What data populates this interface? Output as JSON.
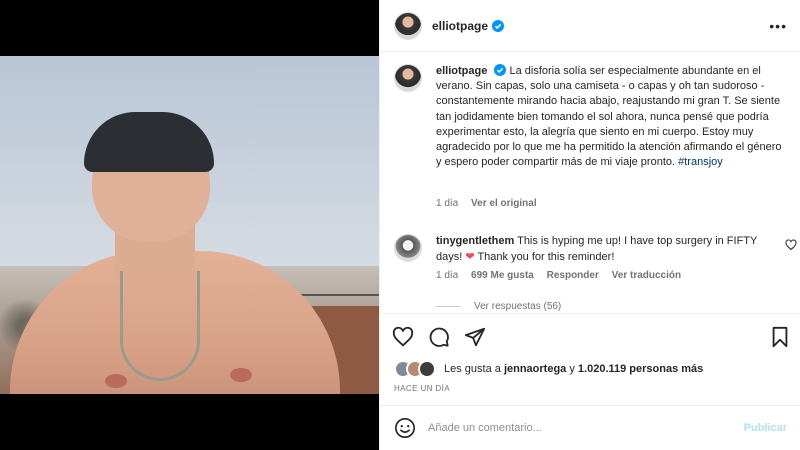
{
  "post": {
    "username": "elliotpage",
    "caption": "La disforia solía ser especialmente abundante en el verano. Sin capas, solo una camiseta - o capas y oh tan sudoroso - constantemente mirando hacia abajo, reajustando mi gran T. Se siente tan jodidamente bien tomando el sol ahora, nunca pensé que podría experimentar esto, la alegría que siento en mi cuerpo. Estoy muy agradecido por lo que me ha permitido la atención afirmando el género y espero poder compartir más de mi viaje pronto.",
    "hashtag": "#transjoy",
    "caption_time": "1 día",
    "see_original": "Ver el original"
  },
  "comment": {
    "username": "tinygentlethem",
    "text_before_heart": "This is hyping me up! I have top surgery in FIFTY days!",
    "text_after_heart": "Thank you for this reminder!",
    "time": "1 día",
    "likes": "699 Me gusta",
    "reply": "Responder",
    "translate": "Ver traducción",
    "view_replies": "Ver respuestas (56)"
  },
  "likes": {
    "prefix": "Les gusta a",
    "user": "jennaortega",
    "connector": "y",
    "count": "1.020.119 personas más"
  },
  "time_ago": "HACE UN DÍA",
  "composer": {
    "placeholder": "Añade un comentario...",
    "publish": "Publicar"
  },
  "icons": [
    "more-icon",
    "verified-icon",
    "heart-icon",
    "comment-icon",
    "share-icon",
    "save-icon",
    "emoji-icon"
  ],
  "colors": {
    "verified": "#0095f6",
    "link": "#00376b",
    "heart": "#ed4956",
    "publish_disabled": "#b2dffc"
  }
}
